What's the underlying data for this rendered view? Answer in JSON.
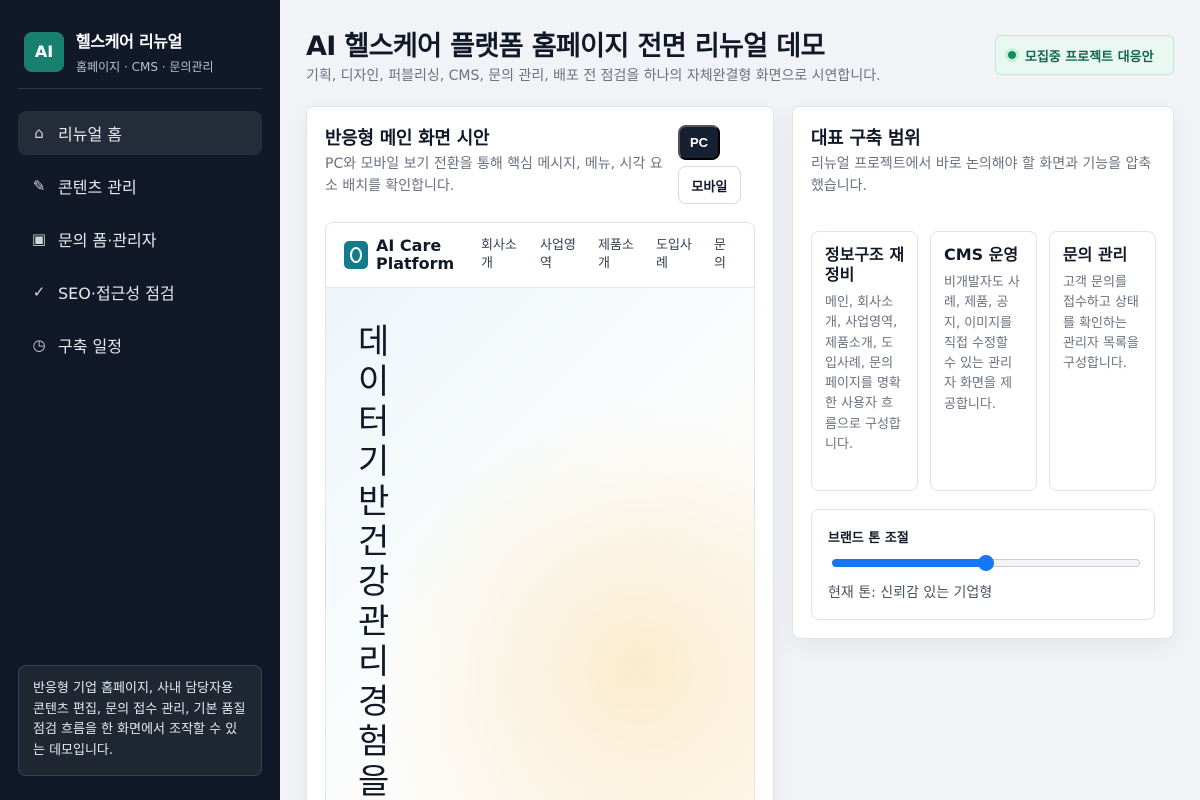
{
  "sidebar": {
    "logo": "AI",
    "title": "헬스케어 리뉴얼",
    "subtitle": "홈페이지 · CMS · 문의관리",
    "items": [
      {
        "icon": "⌂",
        "label": "리뉴얼 홈"
      },
      {
        "icon": "✎",
        "label": "콘텐츠 관리"
      },
      {
        "icon": "▣",
        "label": "문의 폼·관리자"
      },
      {
        "icon": "✓",
        "label": "SEO·접근성 점검"
      },
      {
        "icon": "◷",
        "label": "구축 일정"
      }
    ],
    "note": "반응형 기업 홈페이지, 사내 담당자용 콘텐츠 편집, 문의 접수 관리, 기본 품질 점검 흐름을 한 화면에서 조작할 수 있는 데모입니다."
  },
  "header": {
    "title": "AI 헬스케어 플랫폼 홈페이지 전면 리뉴얼 데모",
    "subtitle": "기획, 디자인, 퍼블리싱, CMS, 문의 관리, 배포 전 점검을 하나의 자체완결형 화면으로 시연합니다.",
    "badge": "모집중 프로젝트 대응안"
  },
  "preview_panel": {
    "title": "반응형 메인 화면 시안",
    "description": "PC와 모바일 보기 전환을 통해 핵심 메시지, 메뉴, 시각 요소 배치를 확인합니다.",
    "pc_label": "PC",
    "mobile_label": "모바일",
    "site": {
      "brand": "AI Care Platform",
      "menu": [
        "회사소개",
        "사업영역",
        "제품소개",
        "도입사례",
        "문의"
      ],
      "hero_title": "데이터기반건강관리경험을"
    }
  },
  "scope_panel": {
    "title": "대표 구축 범위",
    "description": "리뉴얼 프로젝트에서 바로 논의해야 할 화면과 기능을 압축했습니다.",
    "features": [
      {
        "title": "정보구조 재정비",
        "description": "메인, 회사소개, 사업영역, 제품소개, 도입사례, 문의 페이지를 명확한 사용자 흐름으로 구성합니다."
      },
      {
        "title": "CMS 운영",
        "description": "비개발자도 사례, 제품, 공지, 이미지를 직접 수정할 수 있는 관리자 화면을 제공합니다."
      },
      {
        "title": "문의 관리",
        "description": "고객 문의를 접수하고 상태를 확인하는 관리자 목록을 구성합니다."
      }
    ],
    "tone": {
      "label": "브랜드 톤 조절",
      "value": 50,
      "current_text": "현재 톤: 신뢰감 있는 기업형"
    }
  }
}
